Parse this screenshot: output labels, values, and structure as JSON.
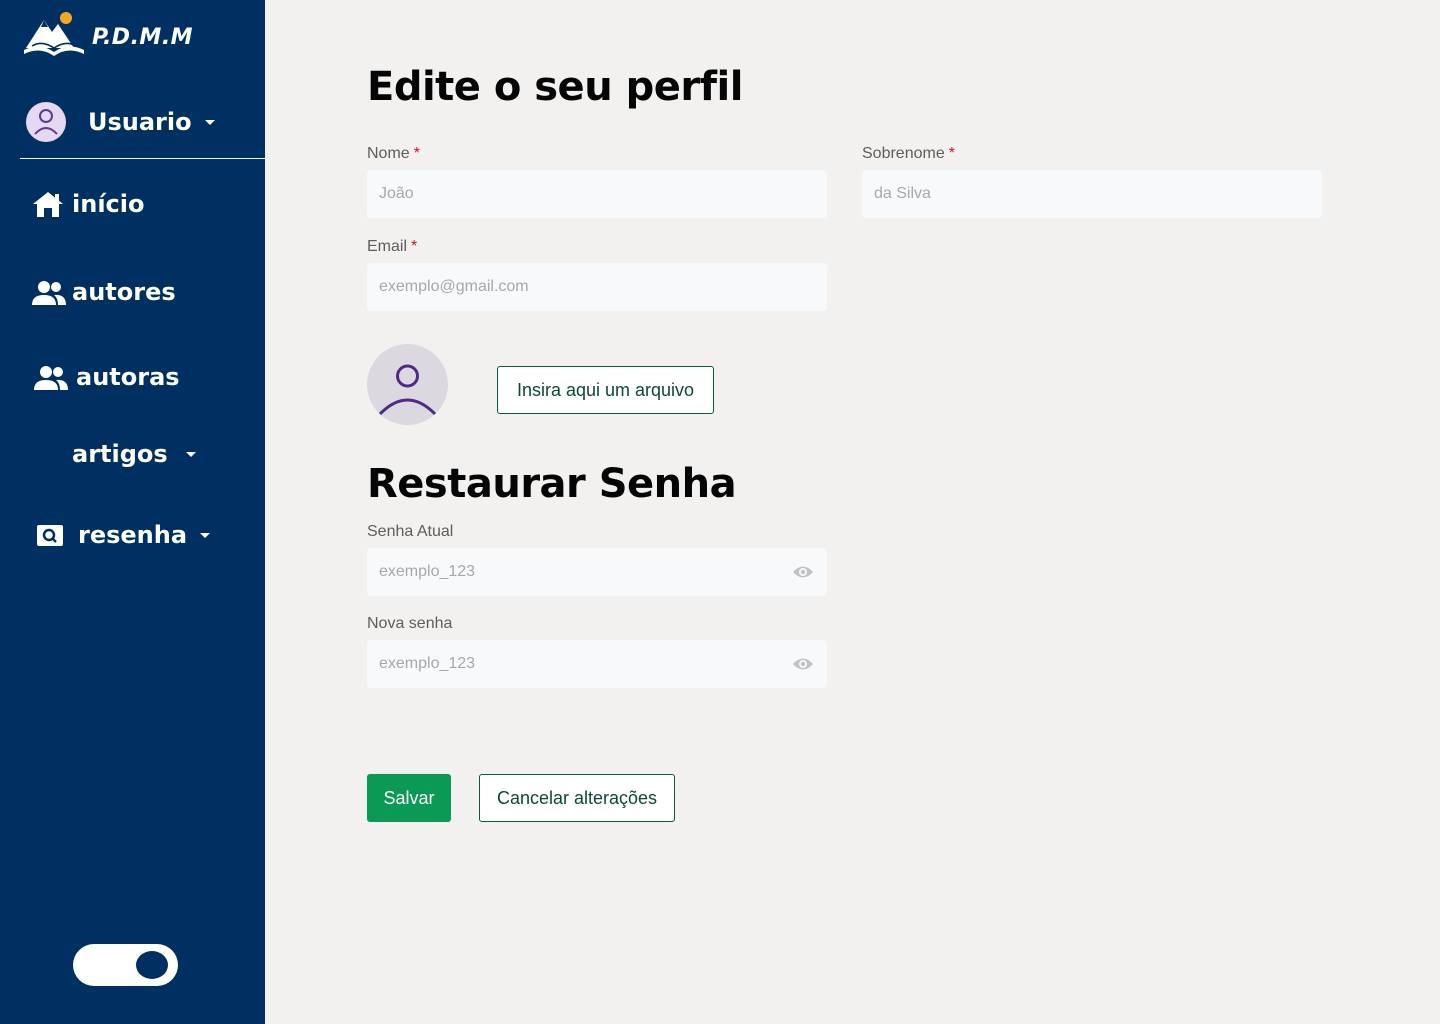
{
  "brand": {
    "name": "P.D.M.M"
  },
  "user": {
    "name": "Usuario"
  },
  "nav": {
    "inicio": "início",
    "autores": "autores",
    "autoras": "autoras",
    "artigos": "artigos",
    "resenha": "resenha"
  },
  "profile": {
    "title": "Edite o seu perfil",
    "first_name": {
      "label": "Nome",
      "required": "*",
      "placeholder": "João"
    },
    "last_name": {
      "label": "Sobrenome",
      "required": "*",
      "placeholder": "da Silva"
    },
    "email": {
      "label": "Email",
      "required": "*",
      "placeholder": "exemplo@gmail.com"
    },
    "upload_label": "Insira aqui um arquivo"
  },
  "password": {
    "title": "Restaurar Senha",
    "current": {
      "label": "Senha Atual",
      "placeholder": "exemplo_123"
    },
    "new": {
      "label": "Nova senha",
      "placeholder": "exemplo_123"
    }
  },
  "actions": {
    "save_label": "Salvar",
    "cancel_label": "Cancelar alterações"
  },
  "colors": {
    "sidebar": "#003061",
    "background": "#f2f1ef",
    "primary": "#0a9a55",
    "required": "#d0112b"
  }
}
